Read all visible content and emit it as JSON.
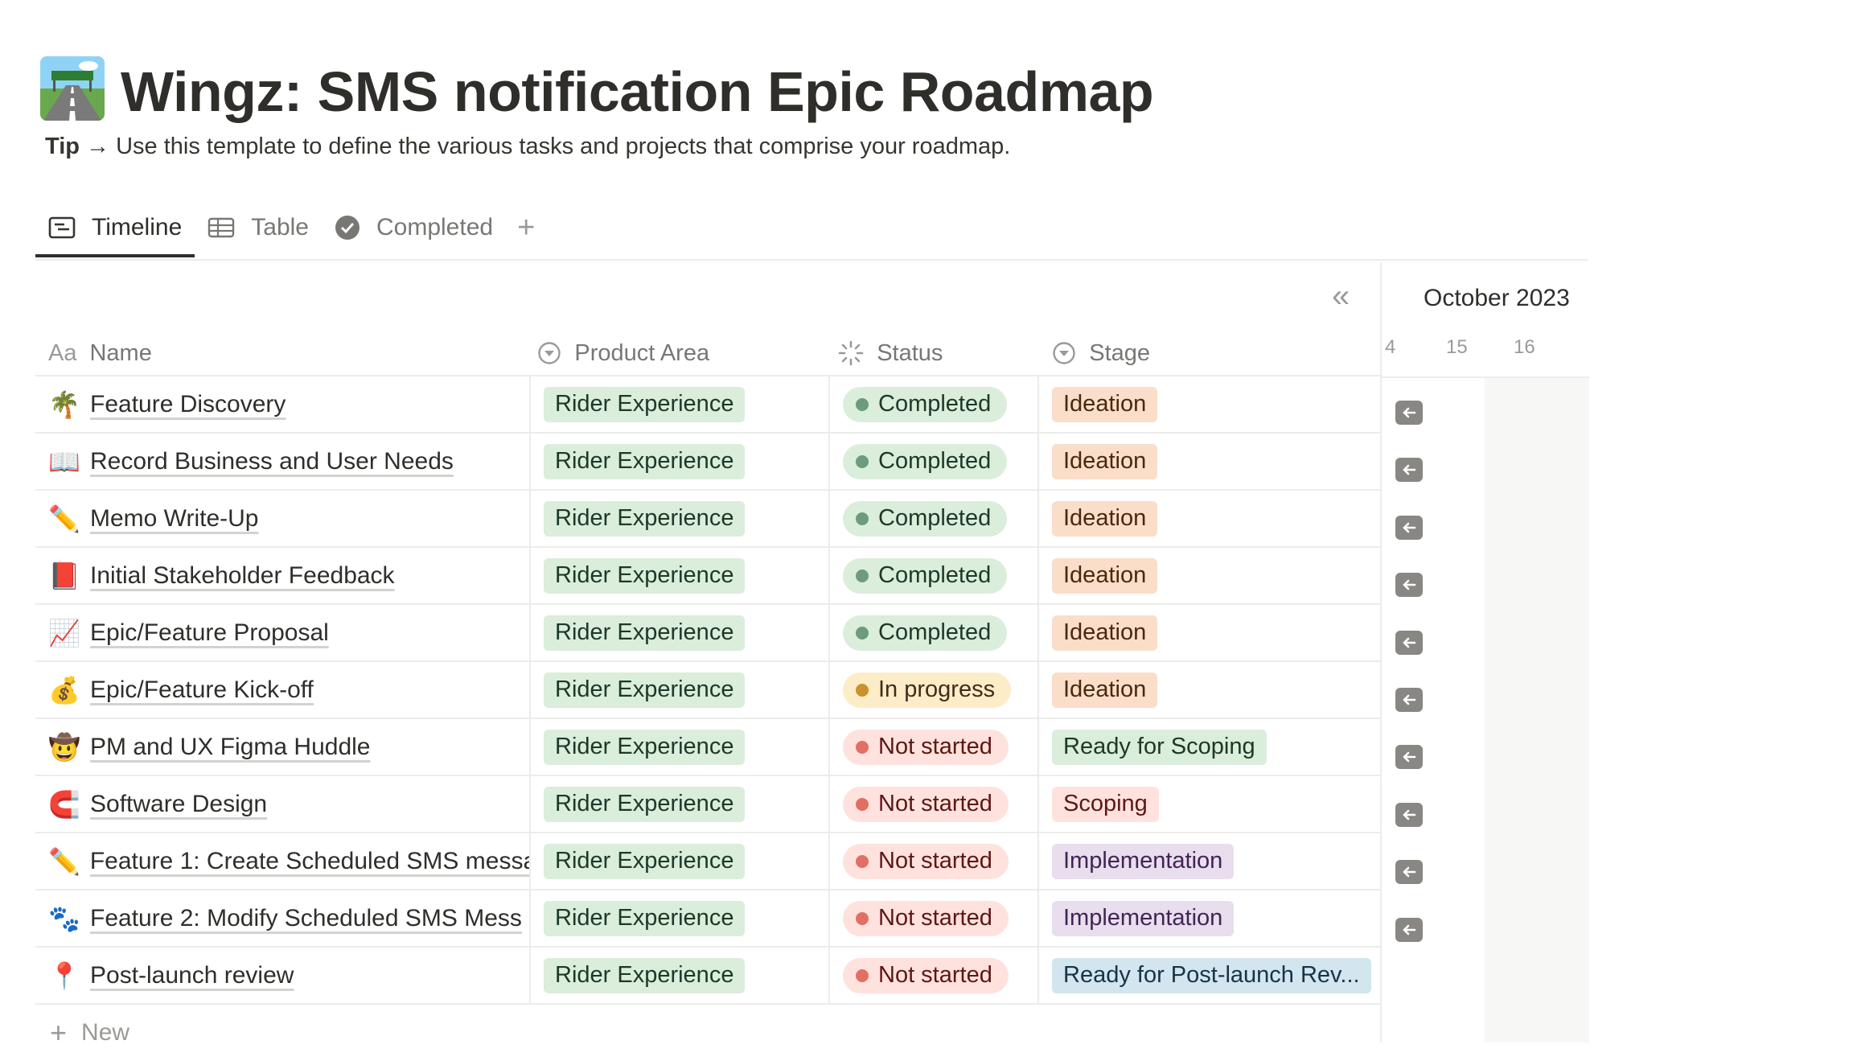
{
  "page": {
    "title": "Wingz: SMS notification Epic Roadmap",
    "icon": "highway-emoji-icon",
    "tip_label": "Tip",
    "tip_text": "→ Use this template to define the various tasks and projects that comprise your roadmap."
  },
  "tabs": [
    {
      "label": "Timeline",
      "icon": "timeline-icon",
      "active": true
    },
    {
      "label": "Table",
      "icon": "table-icon",
      "active": false
    },
    {
      "label": "Completed",
      "icon": "check-circle-icon",
      "active": false
    }
  ],
  "columns": {
    "name": {
      "prefix": "Aa",
      "label": "Name"
    },
    "area": {
      "label": "Product Area",
      "icon": "select-icon"
    },
    "status": {
      "label": "Status",
      "icon": "status-loader-icon"
    },
    "stage": {
      "label": "Stage",
      "icon": "select-icon"
    }
  },
  "rows": [
    {
      "emoji": "🌴",
      "name": "Feature Discovery",
      "area": "Rider Experience",
      "status": "Completed",
      "stage": "Ideation"
    },
    {
      "emoji": "📖",
      "name": "Record Business and User Needs",
      "area": "Rider Experience",
      "status": "Completed",
      "stage": "Ideation"
    },
    {
      "emoji": "✏️",
      "name": "Memo Write-Up",
      "area": "Rider Experience",
      "status": "Completed",
      "stage": "Ideation"
    },
    {
      "emoji": "📕",
      "name": "Initial Stakeholder Feedback",
      "area": "Rider Experience",
      "status": "Completed",
      "stage": "Ideation"
    },
    {
      "emoji": "📈",
      "name": "Epic/Feature Proposal",
      "area": "Rider Experience",
      "status": "Completed",
      "stage": "Ideation"
    },
    {
      "emoji": "💰",
      "name": "Epic/Feature Kick-off",
      "area": "Rider Experience",
      "status": "In progress",
      "stage": "Ideation"
    },
    {
      "emoji": "🤠",
      "name": "PM and UX Figma Huddle",
      "area": "Rider Experience",
      "status": "Not started",
      "stage": "Ready for Scoping"
    },
    {
      "emoji": "🧲",
      "name": "Software Design",
      "area": "Rider Experience",
      "status": "Not started",
      "stage": "Scoping"
    },
    {
      "emoji": "✏️",
      "name": "Feature 1: Create Scheduled SMS messa",
      "area": "Rider Experience",
      "status": "Not started",
      "stage": "Implementation"
    },
    {
      "emoji": "🐾",
      "name": "Feature 2: Modify Scheduled SMS Mess",
      "area": "Rider Experience",
      "status": "Not started",
      "stage": "Implementation"
    },
    {
      "emoji": "📍",
      "name": "Post-launch review",
      "area": "Rider Experience",
      "status": "Not started",
      "stage": "Ready for Post-launch Rev..."
    }
  ],
  "new_row_label": "New",
  "timeline": {
    "month": "October 2023",
    "days": [
      "4",
      "15",
      "16"
    ],
    "collapse_icon": "double-chevron-left-icon",
    "row_button_icon": "arrow-left-icon"
  },
  "colors": {
    "Completed": {
      "bg": "#dbeddb",
      "text": "#1c3829",
      "dot": "#6c9b7d"
    },
    "In progress": {
      "bg": "#fdecc8",
      "text": "#402c1b",
      "dot": "#cb912f"
    },
    "Not started": {
      "bg": "#ffe2dd",
      "text": "#5d1715",
      "dot": "#e16f64"
    },
    "Ideation": {
      "bg": "#fadec9",
      "text": "#49290e"
    },
    "Ready for Scoping": {
      "bg": "#dbeddb",
      "text": "#1c3829"
    },
    "Scoping": {
      "bg": "#ffe2dd",
      "text": "#5d1715"
    },
    "Implementation": {
      "bg": "#e8deee",
      "text": "#412454"
    },
    "Ready for Post-launch Rev...": {
      "bg": "#d3e5ef",
      "text": "#183347"
    }
  }
}
